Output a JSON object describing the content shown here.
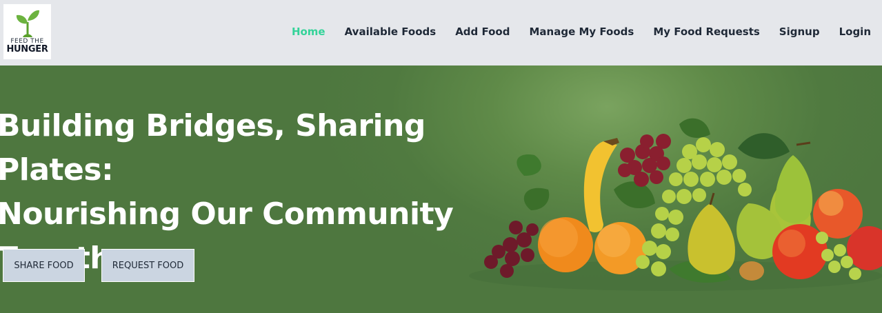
{
  "logo": {
    "line1": "FEED THE",
    "line2": "HUNGER"
  },
  "nav": {
    "items": [
      {
        "label": "Home",
        "active": true
      },
      {
        "label": "Available Foods",
        "active": false
      },
      {
        "label": "Add Food",
        "active": false
      },
      {
        "label": "Manage My Foods",
        "active": false
      },
      {
        "label": "My Food Requests",
        "active": false
      },
      {
        "label": "Signup",
        "active": false
      },
      {
        "label": "Login",
        "active": false
      }
    ]
  },
  "hero": {
    "title_line1": "Building Bridges, Sharing Plates:",
    "title_line2": "Nourishing Our Community",
    "title_line3": "Together",
    "share_button": "SHARE FOOD",
    "request_button": "REQUEST FOOD"
  },
  "colors": {
    "nav_bg": "#e5e7eb",
    "active_link": "#34d399",
    "hero_bg": "#4e773f",
    "button_bg": "#cbd5e1"
  }
}
